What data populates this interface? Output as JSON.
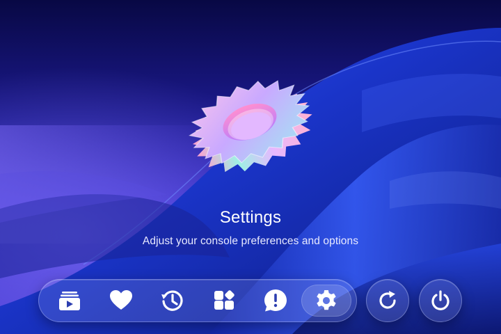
{
  "page": {
    "title": "Settings",
    "subtitle": "Adjust your console preferences and options"
  },
  "dock": {
    "items": [
      {
        "id": "media",
        "icon": "media-library-icon",
        "label": "Media",
        "active": false
      },
      {
        "id": "favorites",
        "icon": "heart-icon",
        "label": "Favorites",
        "active": false
      },
      {
        "id": "history",
        "icon": "history-icon",
        "label": "History",
        "active": false
      },
      {
        "id": "apps",
        "icon": "apps-grid-icon",
        "label": "Apps",
        "active": false
      },
      {
        "id": "notifications",
        "icon": "alert-bubble-icon",
        "label": "Notifications",
        "active": false
      },
      {
        "id": "settings",
        "icon": "gear-icon",
        "label": "Settings",
        "active": true
      }
    ],
    "actions": [
      {
        "id": "refresh",
        "icon": "refresh-icon",
        "label": "Refresh"
      },
      {
        "id": "power",
        "icon": "power-icon",
        "label": "Power"
      }
    ]
  },
  "colors": {
    "background_top": "#0a0a4a",
    "background_mid": "#2a23b8",
    "wave_blue": "#1f3fd6",
    "icon": "#ffffff",
    "hero_gradient": [
      "#f6b6e6",
      "#c8a6ff",
      "#9fe6f0"
    ]
  }
}
